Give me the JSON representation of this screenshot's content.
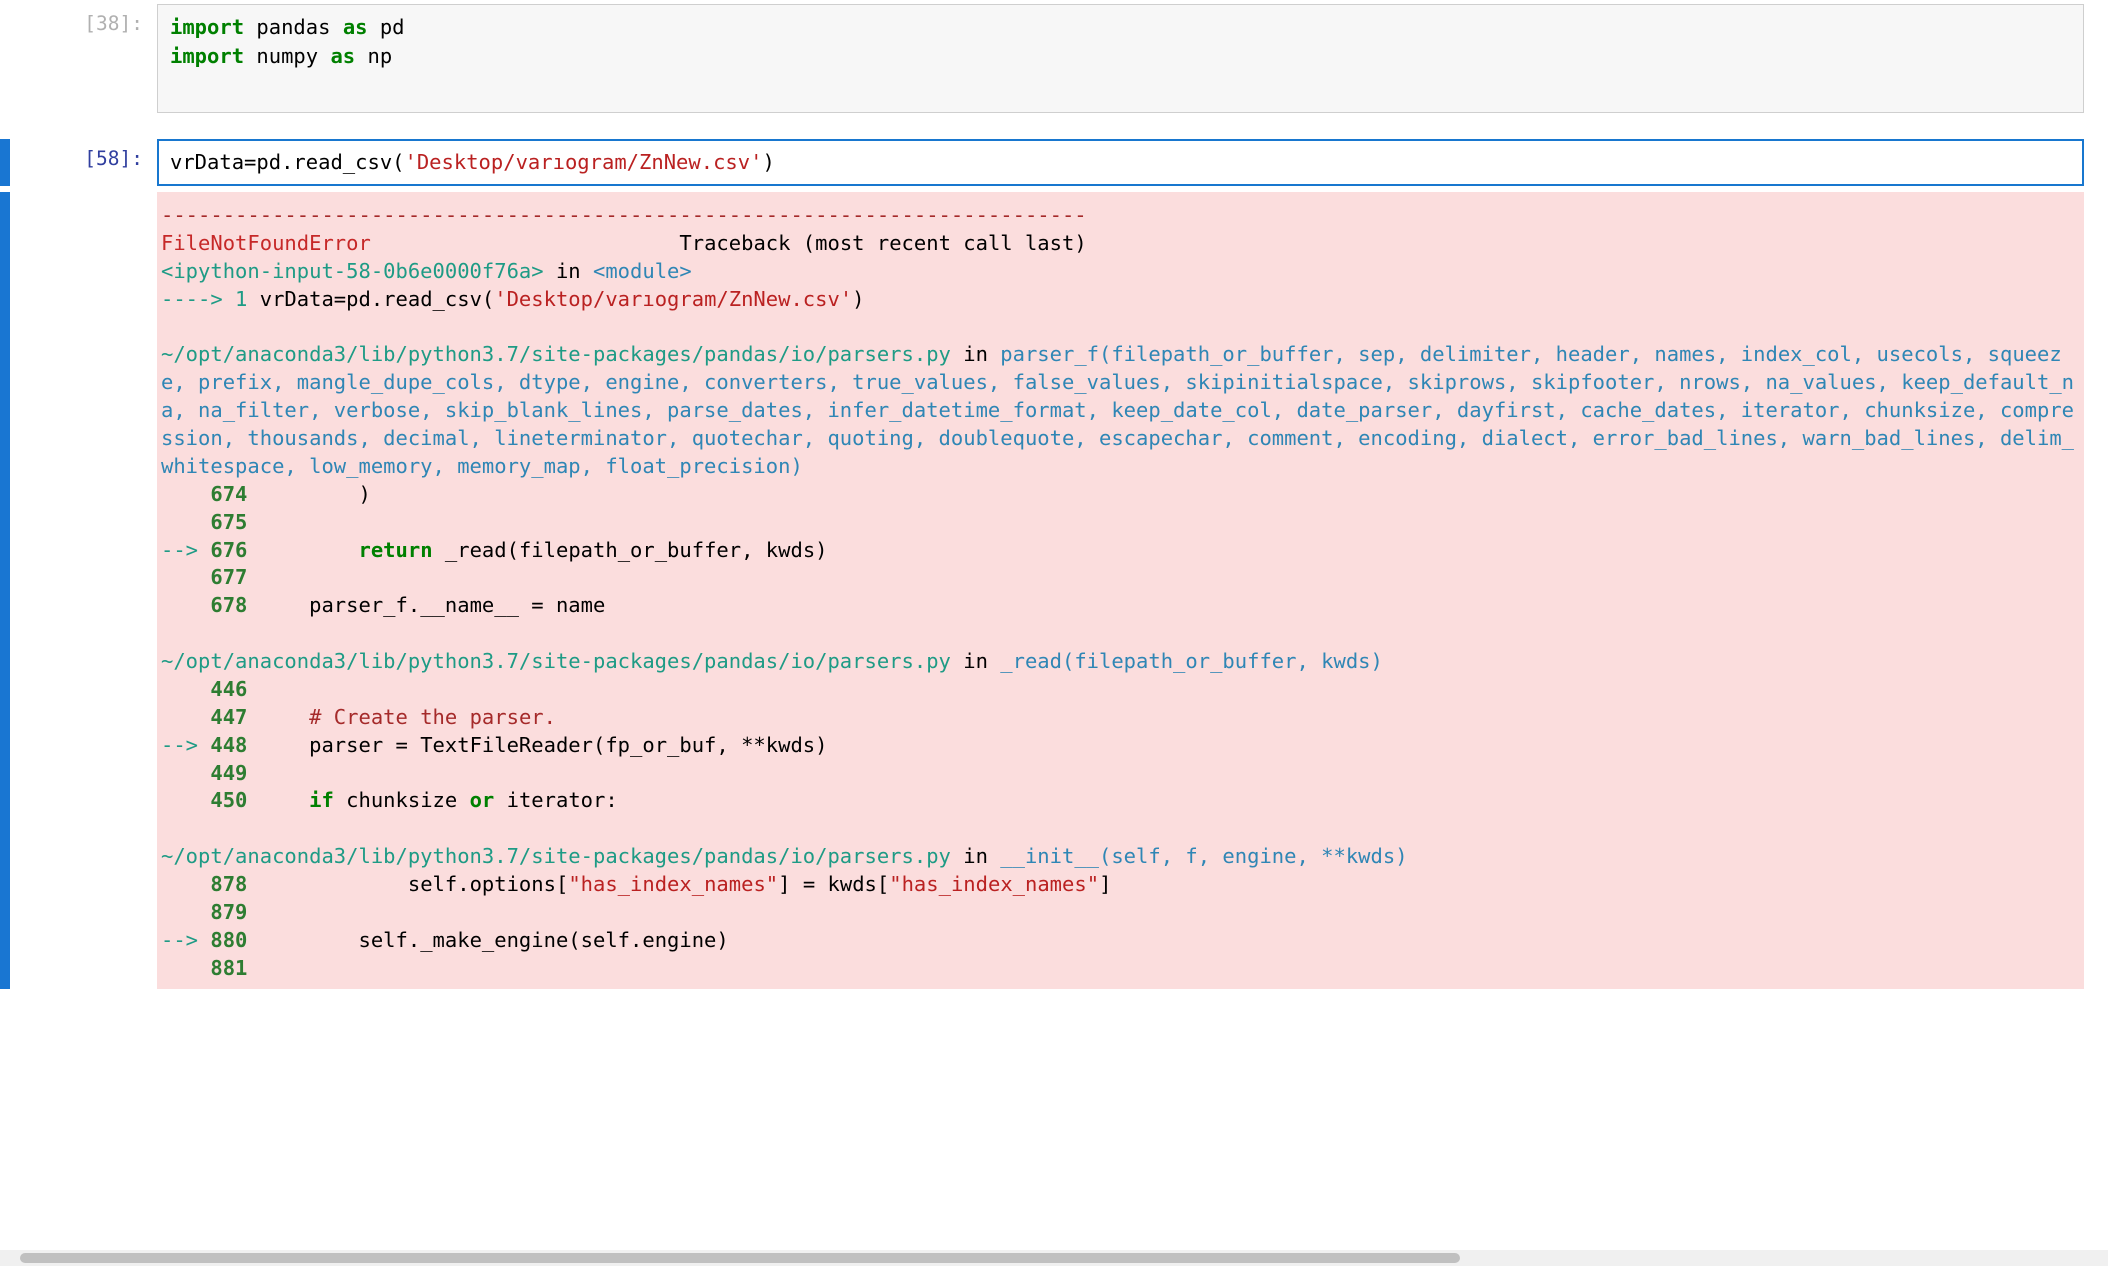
{
  "cells": {
    "cell0": {
      "prompt": "[38]:",
      "code": {
        "l1": {
          "kw1": "import",
          "mod1": " pandas ",
          "kw2": "as",
          "mod2": " pd"
        },
        "l2": {
          "kw1": "import",
          "mod1": " numpy ",
          "kw2": "as",
          "mod2": " np"
        }
      }
    },
    "cell1": {
      "prompt": "[58]:",
      "code": {
        "pre": "vrData=pd.read_csv(",
        "str_open": "'",
        "str_a": "Deskto",
        "str_caret": "p",
        "str_b": "/varıogram/ZnNew.csv",
        "str_close": "'",
        "post": ")"
      }
    }
  },
  "traceback": {
    "sep": "---------------------------------------------------------------------------",
    "err_name": "FileNotFoundError",
    "err_pad": "                         ",
    "err_rest": "Traceback (most recent call last)",
    "frame_in_1": "<ipython-input-58-0b6e0000f76a>",
    "frame_in_2": " in ",
    "frame_in_3": "<module>",
    "arrow1": "----> 1",
    "call1_pre": " vrData=pd.read_csv(",
    "call1_str": "'Desktop/varıogram/ZnNew.csv'",
    "call1_post": ")",
    "path1": "~/opt/anaconda3/lib/python3.7/site-packages/pandas/io/parsers.py",
    "in": " in ",
    "sig1": "parser_f(filepath_or_buffer, sep, delimiter, header, names, index_col, usecols, squeeze, prefix, mangle_dupe_cols, dtype, engine, converters, true_values, false_values, skipinitialspace, skiprows, skipfooter, nrows, na_values, keep_default_na, na_filter, verbose, skip_blank_lines, parse_dates, infer_datetime_format, keep_date_col, date_parser, dayfirst, cache_dates, iterator, chunksize, compression, thousands, decimal, lineterminator, quotechar, quoting, doublequote, escapechar, comment, encoding, dialect, error_bad_lines, warn_bad_lines, delim_whitespace, low_memory, memory_map, float_precision)",
    "l674_no": "674",
    "l674": "         )",
    "l675_no": "675",
    "l675": " ",
    "arrow676": "--> ",
    "l676_no": "676",
    "l676_a": "         ",
    "l676_kw": "return",
    "l676_b": " _read(filepath_or_buffer, kwds)",
    "l677_no": "677",
    "l677": " ",
    "l678_no": "678",
    "l678": "     parser_f.__name__ = name",
    "path2": "~/opt/anaconda3/lib/python3.7/site-packages/pandas/io/parsers.py",
    "sig2": "_read(filepath_or_buffer, kwds)",
    "l446_no": "446",
    "l446": " ",
    "l447_no": "447",
    "l447_a": "     ",
    "l447_cmt": "# Create the parser.",
    "arrow448": "--> ",
    "l448_no": "448",
    "l448": "     parser = TextFileReader(fp_or_buf, **kwds)",
    "l449_no": "449",
    "l449": " ",
    "l450_no": "450",
    "l450_a": "     ",
    "l450_kw": "if",
    "l450_b": " chunksize ",
    "l450_kw2": "or",
    "l450_c": " iterator:",
    "path3": "~/opt/anaconda3/lib/python3.7/site-packages/pandas/io/parsers.py",
    "sig3": "__init__(self, f, engine, **kwds)",
    "l878_no": "878",
    "l878_a": "             self.options[",
    "l878_s1": "\"has_index_names\"",
    "l878_b": "] = kwds[",
    "l878_s2": "\"has_index_names\"",
    "l878_c": "]",
    "l879_no": "879",
    "l879": " ",
    "arrow880": "--> ",
    "l880_no": "880",
    "l880": "         self._make_engine(self.engine)",
    "l881_no": "881",
    "l881": " "
  }
}
